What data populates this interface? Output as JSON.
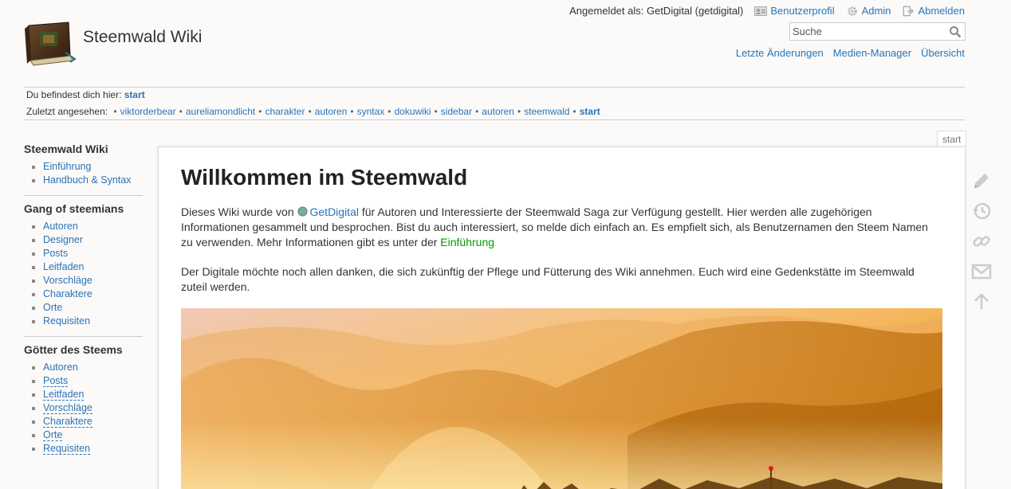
{
  "site": {
    "title": "Steemwald Wiki",
    "logo": "book-logo"
  },
  "user_tools": {
    "logged_in": "Angemeldet als: GetDigital (getdigital)",
    "profile": "Benutzerprofil",
    "admin": "Admin",
    "logout": "Abmelden"
  },
  "search": {
    "placeholder": "Suche"
  },
  "site_tools": {
    "recent": "Letzte Änderungen",
    "media": "Medien-Manager",
    "index": "Übersicht"
  },
  "breadcrumbs": {
    "here_label": "Du befindest dich hier:",
    "here_page": "start",
    "trace_label": "Zuletzt angesehen:",
    "trace": [
      "viktorderbear",
      "aureliamondlicht",
      "charakter",
      "autoren",
      "syntax",
      "dokuwiki",
      "sidebar",
      "autoren",
      "steemwald",
      "start"
    ]
  },
  "sidebar": {
    "sections": [
      {
        "heading": "Steemwald Wiki",
        "items": [
          {
            "label": "Einführung",
            "wanted": false
          },
          {
            "label": "Handbuch & Syntax",
            "wanted": false
          }
        ]
      },
      {
        "heading": "Gang of steemians",
        "items": [
          {
            "label": "Autoren",
            "wanted": false
          },
          {
            "label": "Designer",
            "wanted": false
          },
          {
            "label": "Posts",
            "wanted": false
          },
          {
            "label": "Leitfaden",
            "wanted": false
          },
          {
            "label": "Vorschläge",
            "wanted": false
          },
          {
            "label": "Charaktere",
            "wanted": false
          },
          {
            "label": "Orte",
            "wanted": false
          },
          {
            "label": "Requisiten",
            "wanted": false
          }
        ]
      },
      {
        "heading": "Götter des Steems",
        "items": [
          {
            "label": "Autoren",
            "wanted": false
          },
          {
            "label": "Posts",
            "wanted": true
          },
          {
            "label": "Leitfaden",
            "wanted": true
          },
          {
            "label": "Vorschläge",
            "wanted": true
          },
          {
            "label": "Charaktere",
            "wanted": true
          },
          {
            "label": "Orte",
            "wanted": true
          },
          {
            "label": "Requisiten",
            "wanted": true
          }
        ]
      }
    ]
  },
  "page": {
    "tab": "start",
    "title": "Willkommen im Steemwald",
    "para1": {
      "before": "Dieses Wiki wurde von ",
      "link": "GetDigital",
      "middle": " für Autoren und Interessierte der Steemwald Saga zur Verfügung gestellt. Hier werden alle zugehörigen Informationen gesammelt und besprochen. Bist du auch interessiert, so melde dich einfach an. Es empfielt sich, als Benutzernamen den Steem Namen zu verwenden. Mehr Informationen gibt es unter der ",
      "link2": "Einführung"
    },
    "para2": "Der Digitale möchte noch allen danken, die sich zukünftig der Pflege und Fütterung des Wiki annehmen. Euch wird eine Gedenkstätte im Steemwald zuteil werden.",
    "image": "misty-forest-sunrise-image"
  },
  "page_tools": [
    "edit-icon",
    "history-icon",
    "backlinks-icon",
    "subscribe-icon",
    "top-icon"
  ],
  "colors": {
    "link": "#2b73b7",
    "internal_link": "#009900",
    "background": "#fbfaf9"
  }
}
